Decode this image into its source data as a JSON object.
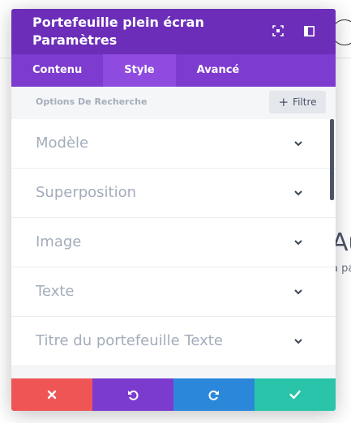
{
  "background": {
    "heading_fragment": "Au",
    "text_fragment": "a pa"
  },
  "modal": {
    "title_line1": "Portefeuille plein écran",
    "title_line2": "Paramètres",
    "header_icons": [
      "expand-icon",
      "sidebar-icon"
    ],
    "tabs": [
      {
        "label": "Contenu",
        "active": false
      },
      {
        "label": "Style",
        "active": true
      },
      {
        "label": "Avancé",
        "active": false
      }
    ],
    "search": {
      "label": "Options De Recherche",
      "filter_label": "Filtre"
    },
    "sections": [
      {
        "label": "Modèle"
      },
      {
        "label": "Superposition"
      },
      {
        "label": "Image"
      },
      {
        "label": "Texte"
      },
      {
        "label": "Titre du portefeuille Texte"
      }
    ],
    "footer": {
      "buttons": [
        "close-icon",
        "undo-icon",
        "redo-icon",
        "check-icon"
      ]
    }
  },
  "colors": {
    "header": "#6c2eb9",
    "tabs": "#7d3bcf",
    "active_tab": "#8f4be0",
    "discard": "#ef5555",
    "undo": "#7c3bcf",
    "redo": "#2b87da",
    "save": "#29c4a9"
  }
}
